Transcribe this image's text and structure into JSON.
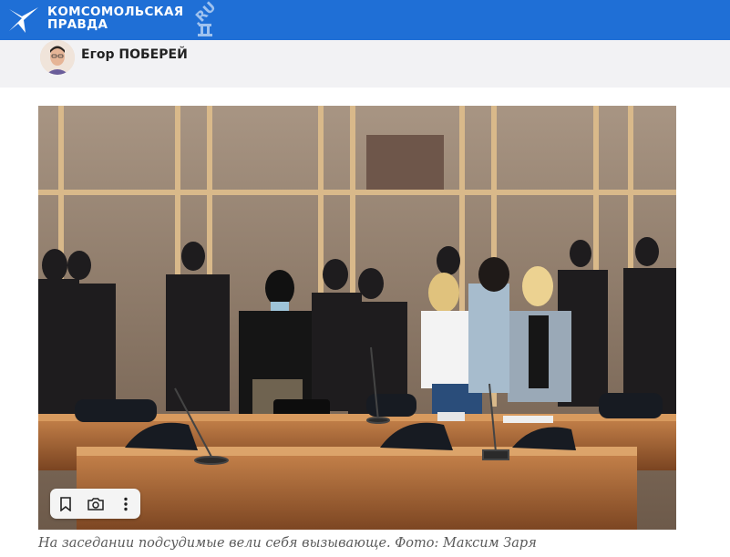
{
  "header": {
    "logo_line1": "КОМСОМОЛЬСКАЯ",
    "logo_line2": "ПРАВДА",
    "logo_domain": ".RU",
    "brand_color": "#1f6fd6"
  },
  "author": {
    "name": "Егор ПОБЕРЕЙ"
  },
  "photo_toolbar": {
    "icons": [
      "bookmark-icon",
      "camera-search-icon",
      "more-vertical-icon"
    ]
  },
  "caption": "На заседании подсудимые вели себя вызывающе. Фото: Максим Заря"
}
